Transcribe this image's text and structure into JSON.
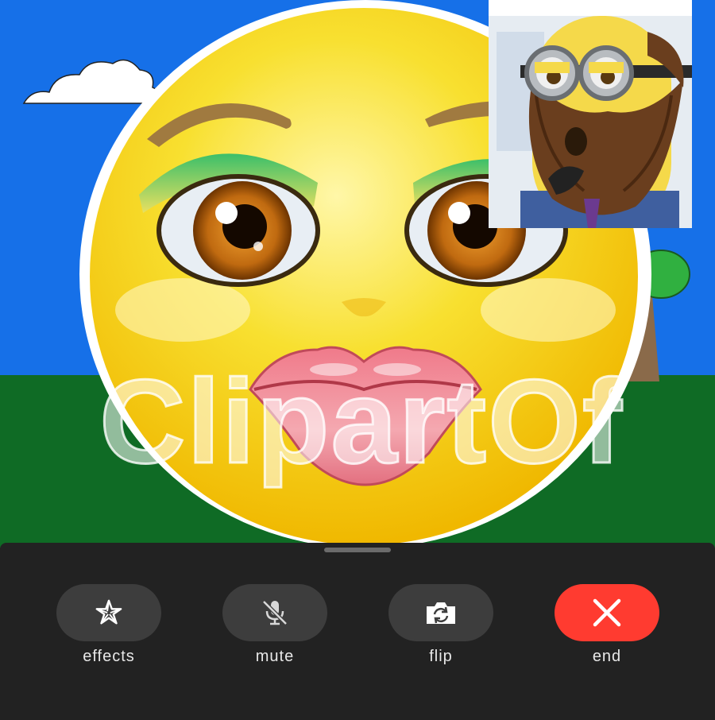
{
  "call": {
    "remote_feed": "smiling-emoji-with-lips-on-cartoon-meadow",
    "watermark": "ClipartOf",
    "self_view": "minion-with-beard"
  },
  "controls": [
    {
      "id": "effects",
      "label": "effects",
      "icon": "star-effects-icon"
    },
    {
      "id": "mute",
      "label": "mute",
      "icon": "microphone-slash-icon"
    },
    {
      "id": "flip",
      "label": "flip",
      "icon": "camera-flip-icon"
    },
    {
      "id": "end",
      "label": "end",
      "icon": "close-icon"
    }
  ],
  "colors": {
    "sky": "#1670e8",
    "grass": "#0f6b25",
    "tray": "#222222",
    "button": "#3d3d3d",
    "end_button": "#ff3b30",
    "emoji": "#f8e030"
  }
}
